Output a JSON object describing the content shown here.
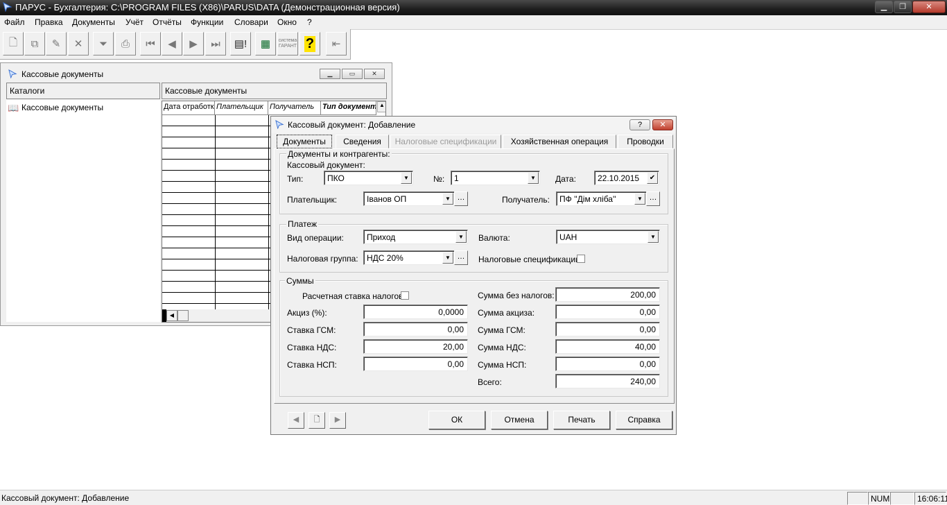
{
  "window": {
    "title": "ПАРУС - Бухгалтерия: C:\\PROGRAM FILES (X86)\\PARUS\\DATA (Демонстрационная версия)"
  },
  "menu": [
    "Файл",
    "Правка",
    "Документы",
    "Учёт",
    "Отчёты",
    "Функции",
    "Словари",
    "Окно",
    "?"
  ],
  "toolbar": {
    "icons": [
      "new-doc-icon",
      "copy-doc-icon",
      "edit-doc-icon",
      "delete-icon",
      "filter-icon",
      "print-icon",
      "first-icon",
      "prev-icon",
      "next-icon",
      "last-icon",
      "list-alert-icon",
      "calculator-icon",
      "garant-icon",
      "help-icon",
      "exit-icon"
    ],
    "garant_label": "система ГАРАНТ",
    "help_glyph": "?"
  },
  "bg_window": {
    "title": "Кассовые документы",
    "catalog_header": "Каталоги",
    "catalog_item": "Кассовые документы",
    "grid_header": "Кассовые документы",
    "columns": [
      "Дата отработки",
      "Плательщик",
      "Получатель",
      "Тип документа"
    ]
  },
  "dialog": {
    "title": "Кассовый документ: Добавление",
    "help_btn": "?",
    "close_btn": "✕",
    "tabs": [
      {
        "label": "Документы",
        "active": true
      },
      {
        "label": "Сведения",
        "disabled": false
      },
      {
        "label": "Налоговые спецификации",
        "disabled": true
      },
      {
        "label": "Хозяйственная операция",
        "disabled": false
      },
      {
        "label": "Проводки",
        "disabled": false
      }
    ],
    "group_docs": {
      "title": "Документы и контрагенты:",
      "subtitle": "Кассовый документ:",
      "type_label": "Тип:",
      "type_value": "ПКО",
      "num_label": "№:",
      "num_value": "1",
      "date_label": "Дата:",
      "date_value": "22.10.2015",
      "payer_label": "Плательщик:",
      "payer_value": "Іванов ОП",
      "recipient_label": "Получатель:",
      "recipient_value": "ПФ ''Дім хліба''"
    },
    "group_payment": {
      "title": "Платеж",
      "optype_label": "Вид операции:",
      "optype_value": "Приход",
      "currency_label": "Валюта:",
      "currency_value": "UAH",
      "taxgroup_label": "Налоговая группа:",
      "taxgroup_value": "НДС 20%",
      "taxspec_label": "Налоговые спецификации:",
      "taxspec_checked": false
    },
    "group_sums": {
      "title": "Суммы",
      "calc_rate_label": "Расчетная ставка налогов:",
      "calc_rate_checked": false,
      "excise_label": "Акциз (%):",
      "excise_value": "0,0000",
      "gsm_rate_label": "Ставка ГСМ:",
      "gsm_rate_value": "0,00",
      "vat_rate_label": "Ставка НДС:",
      "vat_rate_value": "20,00",
      "nsp_rate_label": "Ставка НСП:",
      "nsp_rate_value": "0,00",
      "sum_no_tax_label": "Сумма без налогов:",
      "sum_no_tax_value": "200,00",
      "sum_excise_label": "Сумма акциза:",
      "sum_excise_value": "0,00",
      "sum_gsm_label": "Сумма ГСМ:",
      "sum_gsm_value": "0,00",
      "sum_vat_label": "Сумма НДС:",
      "sum_vat_value": "40,00",
      "sum_nsp_label": "Сумма НСП:",
      "sum_nsp_value": "0,00",
      "total_label": "Всего:",
      "total_value": "240,00"
    },
    "buttons": {
      "ok": "ОК",
      "cancel": "Отмена",
      "print": "Печать",
      "help": "Справка"
    }
  },
  "status": {
    "text": "Кассовый документ: Добавление",
    "num": "NUM",
    "time": "16:06:11"
  }
}
